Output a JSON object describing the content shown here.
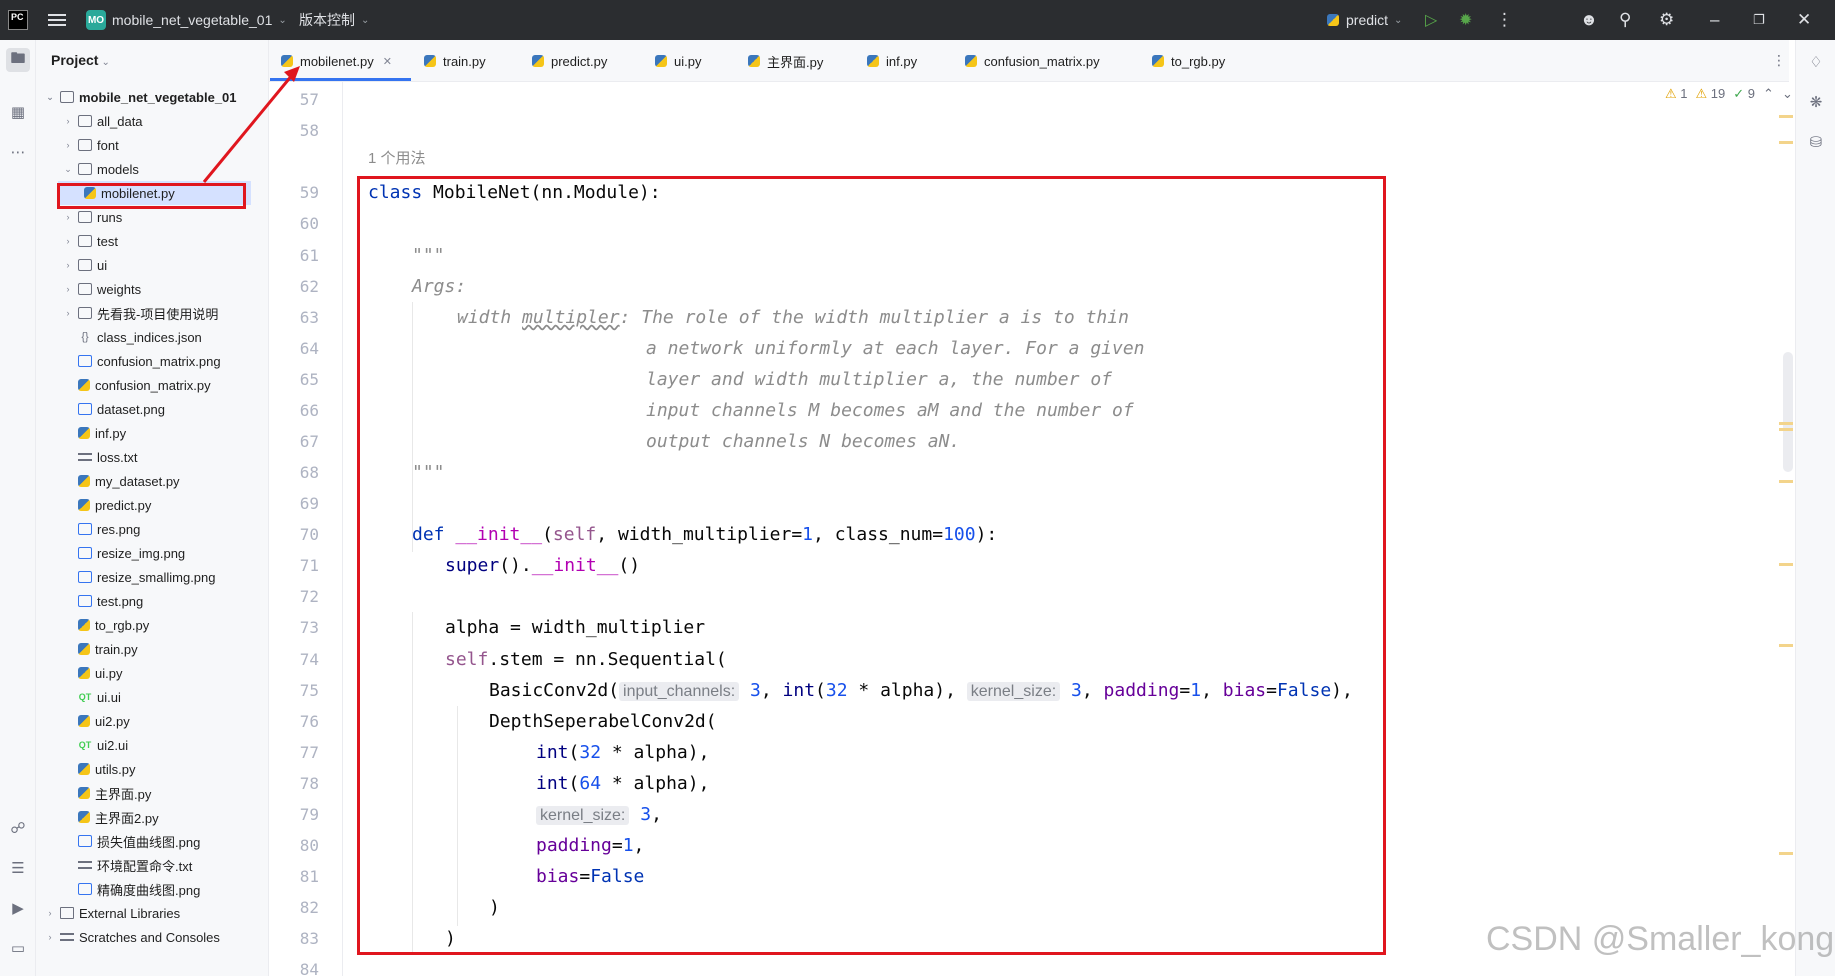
{
  "titlebar": {
    "logo": "PC",
    "project_badge": "MO",
    "project_name": "mobile_net_vegetable_01",
    "vcs_label": "版本控制",
    "run_config": "predict"
  },
  "project_panel": {
    "header": "Project",
    "root": "mobile_net_vegetable_01",
    "items": [
      {
        "label": "all_data",
        "type": "folder",
        "level": 1,
        "expanded": false
      },
      {
        "label": "font",
        "type": "folder",
        "level": 1,
        "expanded": false
      },
      {
        "label": "models",
        "type": "folder",
        "level": 1,
        "expanded": true
      },
      {
        "label": "mobilenet.py",
        "type": "py",
        "level": 2,
        "selected": true
      },
      {
        "label": "runs",
        "type": "folder",
        "level": 1,
        "expanded": false
      },
      {
        "label": "test",
        "type": "folder",
        "level": 1,
        "expanded": false
      },
      {
        "label": "ui",
        "type": "folder",
        "level": 1,
        "expanded": false
      },
      {
        "label": "weights",
        "type": "folder",
        "level": 1,
        "expanded": false
      },
      {
        "label": "先看我-项目使用说明",
        "type": "folder",
        "level": 1,
        "expanded": false
      },
      {
        "label": "class_indices.json",
        "type": "json",
        "level": 1
      },
      {
        "label": "confusion_matrix.png",
        "type": "img",
        "level": 1
      },
      {
        "label": "confusion_matrix.py",
        "type": "py",
        "level": 1
      },
      {
        "label": "dataset.png",
        "type": "img",
        "level": 1
      },
      {
        "label": "inf.py",
        "type": "py",
        "level": 1
      },
      {
        "label": "loss.txt",
        "type": "txt",
        "level": 1
      },
      {
        "label": "my_dataset.py",
        "type": "py",
        "level": 1
      },
      {
        "label": "predict.py",
        "type": "py",
        "level": 1
      },
      {
        "label": "res.png",
        "type": "img",
        "level": 1
      },
      {
        "label": "resize_img.png",
        "type": "img",
        "level": 1
      },
      {
        "label": "resize_smallimg.png",
        "type": "img",
        "level": 1
      },
      {
        "label": "test.png",
        "type": "img",
        "level": 1
      },
      {
        "label": "to_rgb.py",
        "type": "py",
        "level": 1
      },
      {
        "label": "train.py",
        "type": "py",
        "level": 1
      },
      {
        "label": "ui.py",
        "type": "py",
        "level": 1
      },
      {
        "label": "ui.ui",
        "type": "ui",
        "level": 1
      },
      {
        "label": "ui2.py",
        "type": "py",
        "level": 1
      },
      {
        "label": "ui2.ui",
        "type": "ui",
        "level": 1
      },
      {
        "label": "utils.py",
        "type": "py",
        "level": 1
      },
      {
        "label": "主界面.py",
        "type": "py",
        "level": 1
      },
      {
        "label": "主界面2.py",
        "type": "py",
        "level": 1
      },
      {
        "label": "损失值曲线图.png",
        "type": "img",
        "level": 1
      },
      {
        "label": "环境配置命令.txt",
        "type": "txt",
        "level": 1
      },
      {
        "label": "精确度曲线图.png",
        "type": "img",
        "level": 1
      }
    ],
    "external_libraries": "External Libraries",
    "scratches": "Scratches and Consoles"
  },
  "tabs": [
    {
      "label": "mobilenet.py",
      "active": true
    },
    {
      "label": "train.py"
    },
    {
      "label": "predict.py"
    },
    {
      "label": "ui.py"
    },
    {
      "label": "主界面.py"
    },
    {
      "label": "inf.py"
    },
    {
      "label": "confusion_matrix.py"
    },
    {
      "label": "to_rgb.py"
    }
  ],
  "inspections": {
    "warnings_a": "1",
    "warnings_b": "19",
    "ok": "9"
  },
  "editor": {
    "usages": "1 个用法",
    "line_numbers": [
      "57",
      "58",
      "59",
      "60",
      "61",
      "62",
      "63",
      "64",
      "65",
      "66",
      "67",
      "68",
      "69",
      "70",
      "71",
      "72",
      "73",
      "74",
      "75",
      "76",
      "77",
      "78",
      "79",
      "80",
      "81",
      "82",
      "83",
      "84"
    ],
    "code": {
      "l59_kw": "class",
      "l59_rest": " MobileNet(nn.Module):",
      "l61": "\"\"\"",
      "l62": "Args:",
      "l63_a": "width ",
      "l63_b": "multipler",
      "l63_c": ": The role of the width multiplier a is to thin",
      "l64": "a network uniformly at each layer. For a given",
      "l65": "layer and width multiplier a, the number of",
      "l66": "input channels M becomes aM and the number of",
      "l67": "output channels N becomes aN.",
      "l68": "\"\"\"",
      "l70_def": "def",
      "l70_init": "__init__",
      "l70_open": "(",
      "l70_self": "self",
      "l70_mid": ", width_multiplier=",
      "l70_one": "1",
      "l70_mid2": ", class_num=",
      "l70_hundred": "100",
      "l70_end": "):",
      "l71_super": "super",
      "l71_dot": "().",
      "l71_init": "__init__",
      "l71_end": "()",
      "l73": "alpha = width_multiplier",
      "l74_self": "self",
      "l74_rest": ".stem = nn.Sequential(",
      "l75_fn": "BasicConv2d(",
      "l75_hint1": "input_channels:",
      "l75_v1": "3",
      "l75_comma1": ", ",
      "l75_int": "int",
      "l75_paren": "(",
      "l75_32": "32",
      "l75_alpha": " * alpha), ",
      "l75_hint2": "kernel_size:",
      "l75_v2": "3",
      "l75_comma2": ", ",
      "l75_padding": "padding",
      "l75_eq1": "=",
      "l75_v3": "1",
      "l75_comma3": ", ",
      "l75_bias": "bias",
      "l75_eq2": "=",
      "l75_false": "False",
      "l75_end": "),",
      "l76": "DepthSeperabelConv2d(",
      "l77_int": "int",
      "l77_open": "(",
      "l77_32": "32",
      "l77_rest": " * alpha),",
      "l78_int": "int",
      "l78_open": "(",
      "l78_64": "64",
      "l78_rest": " * alpha),",
      "l79_hint": "kernel_size:",
      "l79_v": "3",
      "l79_end": ",",
      "l80_padding": "padding",
      "l80_eq": "=",
      "l80_v": "1",
      "l80_end": ",",
      "l81_bias": "bias",
      "l81_eq": "=",
      "l81_false": "False",
      "l82": ")",
      "l83": ")"
    }
  },
  "watermark": "CSDN @Smaller_kong",
  "colors": {
    "highlight": "#e0161e",
    "accent": "#3574f0"
  }
}
